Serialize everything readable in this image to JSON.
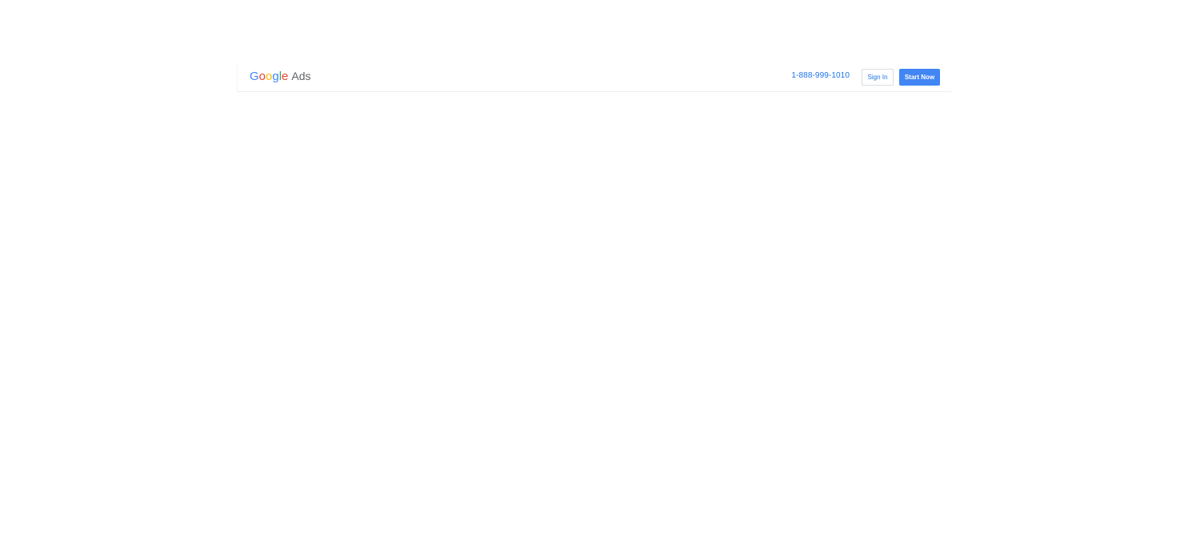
{
  "header": {
    "logo": {
      "letters": [
        {
          "char": "G",
          "color": "#4285F4"
        },
        {
          "char": "o",
          "color": "#EA4335"
        },
        {
          "char": "o",
          "color": "#FBBC05"
        },
        {
          "char": "g",
          "color": "#4285F4"
        },
        {
          "char": "l",
          "color": "#34A853"
        },
        {
          "char": "e",
          "color": "#EA4335"
        }
      ],
      "product": "Ads"
    },
    "phone": "1-888-999-1010",
    "sign_in_label": "Sign In",
    "start_now_label": "Start Now"
  },
  "colors": {
    "accent": "#1a73e8",
    "primary_button": "#4285f4"
  }
}
